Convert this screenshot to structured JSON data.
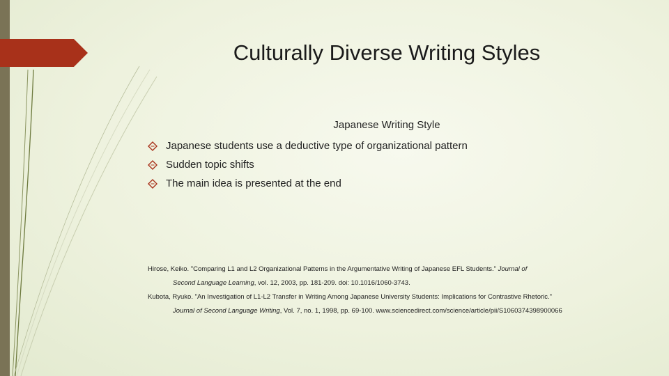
{
  "slide": {
    "title": "Culturally Diverse Writing Styles",
    "subtitle": "Japanese Writing Style",
    "bullets": [
      "Japanese students use a deductive type of organizational pattern",
      "Sudden topic shifts",
      "The main idea is presented at the end"
    ],
    "references": {
      "ref1_line1_a": "Hirose, Keiko. \"Comparing L1 and L2 Organizational Patterns in the Argumentative Writing of Japanese EFL Students.\"",
      "ref1_line1_journal": "Journal of",
      "ref1_line2_journal": "Second Language Learning",
      "ref1_line2_b": ", vol. 12, 2003, pp. 181-209. doi: 10.1016/1060-3743.",
      "ref2_line1": "Kubota, Ryuko. \"An Investigation of L1-L2 Transfer in Writing Among Japanese University Students: Implications for Contrastive Rhetoric.\"",
      "ref2_line2_journal": "Journal of Second Language Writing",
      "ref2_line2_b": ", Vol. 7, no. 1, 1998, pp. 69-100. www.sciencedirect.com/science/article/pii/S1060374398900066"
    }
  },
  "colors": {
    "accent_tab": "#a8311a",
    "left_bar": "#7a7356",
    "background": "#eef2de"
  },
  "icons": {
    "bullet": "diamond-outline-icon"
  }
}
